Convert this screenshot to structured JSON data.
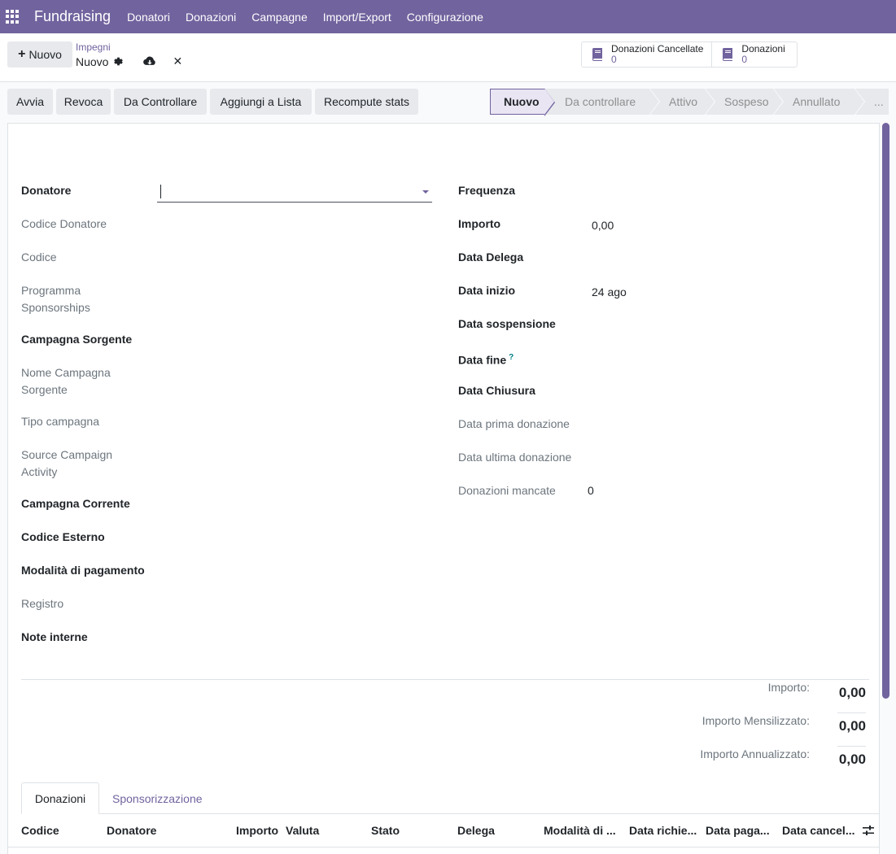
{
  "navbar": {
    "brand": "Fundraising",
    "menu": [
      "Donatori",
      "Donazioni",
      "Campagne",
      "Import/Export",
      "Configurazione"
    ]
  },
  "control": {
    "new_label": "Nuovo",
    "breadcrumb": "Impegni",
    "record_name": "Nuovo",
    "smart_buttons": [
      {
        "label": "Donazioni Cancellate",
        "value": "0",
        "icon": "book-icon"
      },
      {
        "label": "Donazioni",
        "value": "0",
        "icon": "book-icon"
      }
    ]
  },
  "actions": {
    "buttons": [
      "Avvia",
      "Revoca",
      "Da Controllare",
      "Aggiungi a Lista",
      "Recompute stats"
    ],
    "stages": [
      "Nuovo",
      "Da controllare",
      "Attivo",
      "Sospeso",
      "Annullato",
      "..."
    ]
  },
  "form": {
    "left": [
      {
        "label": "Donatore"
      },
      {
        "label": "Codice Donatore"
      },
      {
        "label": "Codice"
      },
      {
        "label": "Programma Sponsorships"
      },
      {
        "label": "Campagna Sorgente"
      },
      {
        "label": "Nome Campagna Sorgente"
      },
      {
        "label": "Tipo campagna"
      },
      {
        "label": "Source Campaign Activity"
      },
      {
        "label": "Campagna Corrente"
      },
      {
        "label": "Codice Esterno"
      },
      {
        "label": "Modalità di pagamento"
      },
      {
        "label": "Registro"
      },
      {
        "label": "Note interne"
      }
    ],
    "right": [
      {
        "label": "Frequenza",
        "value": ""
      },
      {
        "label": "Importo",
        "value": "0,00"
      },
      {
        "label": "Data Delega",
        "value": ""
      },
      {
        "label": "Data inizio",
        "value": "24 ago"
      },
      {
        "label": "Data sospensione",
        "value": ""
      },
      {
        "label": "Data fine",
        "value": "",
        "help": "?"
      },
      {
        "label": "Data Chiusura",
        "value": ""
      },
      {
        "label": "Data prima donazione",
        "value": ""
      },
      {
        "label": "Data ultima donazione",
        "value": ""
      },
      {
        "label": "Donazioni mancate",
        "value": "0"
      }
    ]
  },
  "totals": [
    {
      "label": "Importo:",
      "value": "0,00"
    },
    {
      "label": "Importo Mensilizzato:",
      "value": "0,00"
    },
    {
      "label": "Importo Annualizzato:",
      "value": "0,00"
    }
  ],
  "tabs": [
    "Donazioni",
    "Sponsorizzazione"
  ],
  "table": {
    "columns": [
      "Codice",
      "Donatore",
      "Importo",
      "Valuta",
      "Stato",
      "Delega",
      "Modalità di ...",
      "Data richie...",
      "Data paga...",
      "Data cancel..."
    ]
  },
  "colors": {
    "brand": "#71639e",
    "accent_link": "#017e84"
  }
}
